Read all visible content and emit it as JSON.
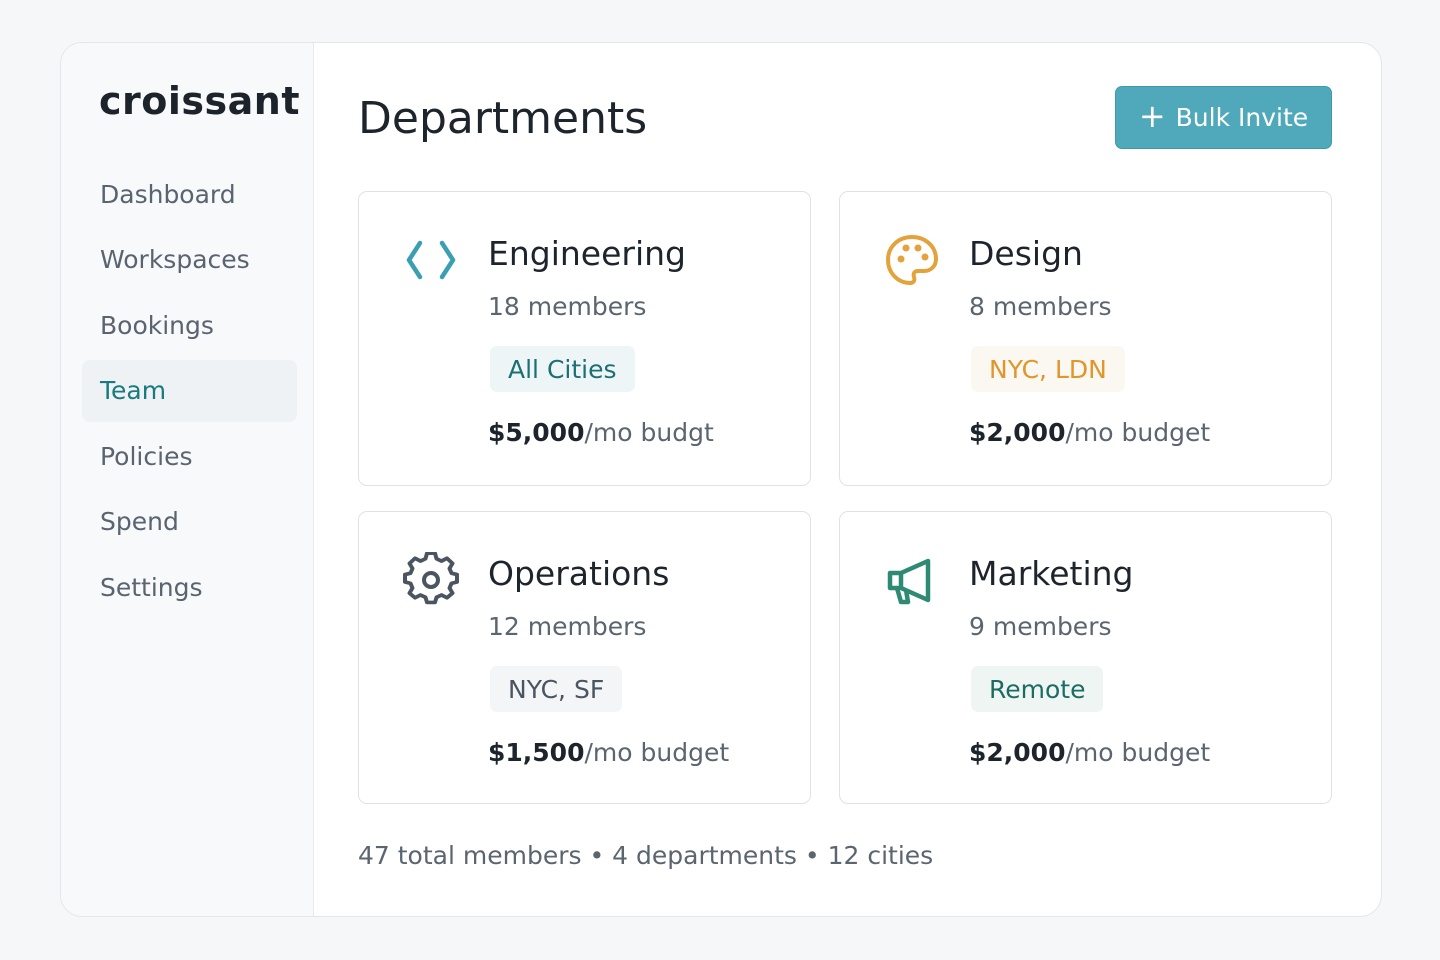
{
  "app": {
    "logo": "croissant"
  },
  "sidebar": {
    "items": [
      {
        "label": "Dashboard"
      },
      {
        "label": "Workspaces"
      },
      {
        "label": "Bookings"
      },
      {
        "label": "Team",
        "active": true
      },
      {
        "label": "Policies"
      },
      {
        "label": "Spend"
      },
      {
        "label": "Settings"
      }
    ]
  },
  "header": {
    "title": "Departments",
    "bulk_invite_label": "Bulk Invite",
    "bulk_invite_icon": "plus-icon"
  },
  "departments": [
    {
      "name": "Engineering",
      "members": "18 members",
      "tag": "All Cities",
      "budget_amount": "$5,000",
      "budget_suffix": "/mo budgt",
      "icon": "code-icon",
      "tag_color": "#1c6f72",
      "tag_bg": "#eef5f7"
    },
    {
      "name": "Design",
      "members": "8 members",
      "tag": "NYC, LDN",
      "budget_amount": "$2,000",
      "budget_suffix": "/mo budget",
      "icon": "palette-icon",
      "tag_color": "#e0962b",
      "tag_bg": "#fbf7f1"
    },
    {
      "name": "Operations",
      "members": "12 members",
      "tag": "NYC, SF",
      "budget_amount": "$1,500",
      "budget_suffix": "/mo budget",
      "icon": "gear-icon",
      "tag_color": "#4a5561",
      "tag_bg": "#f3f5f7"
    },
    {
      "name": "Marketing",
      "members": "9 members",
      "tag": "Remote",
      "budget_amount": "$2,000",
      "budget_suffix": "/mo budget",
      "icon": "megaphone-icon",
      "tag_color": "#1d6c64",
      "tag_bg": "#eef5f3"
    }
  ],
  "summary": {
    "text": "47 total members • 4 departments • 12 cities"
  },
  "colors": {
    "accent": "#4fa9ba",
    "active_nav": "#1a7a7d",
    "code_icon": "#3a9fb3",
    "palette_icon": "#e4a23b",
    "gear_icon": "#4a5561",
    "megaphone_icon": "#2e8a73"
  }
}
